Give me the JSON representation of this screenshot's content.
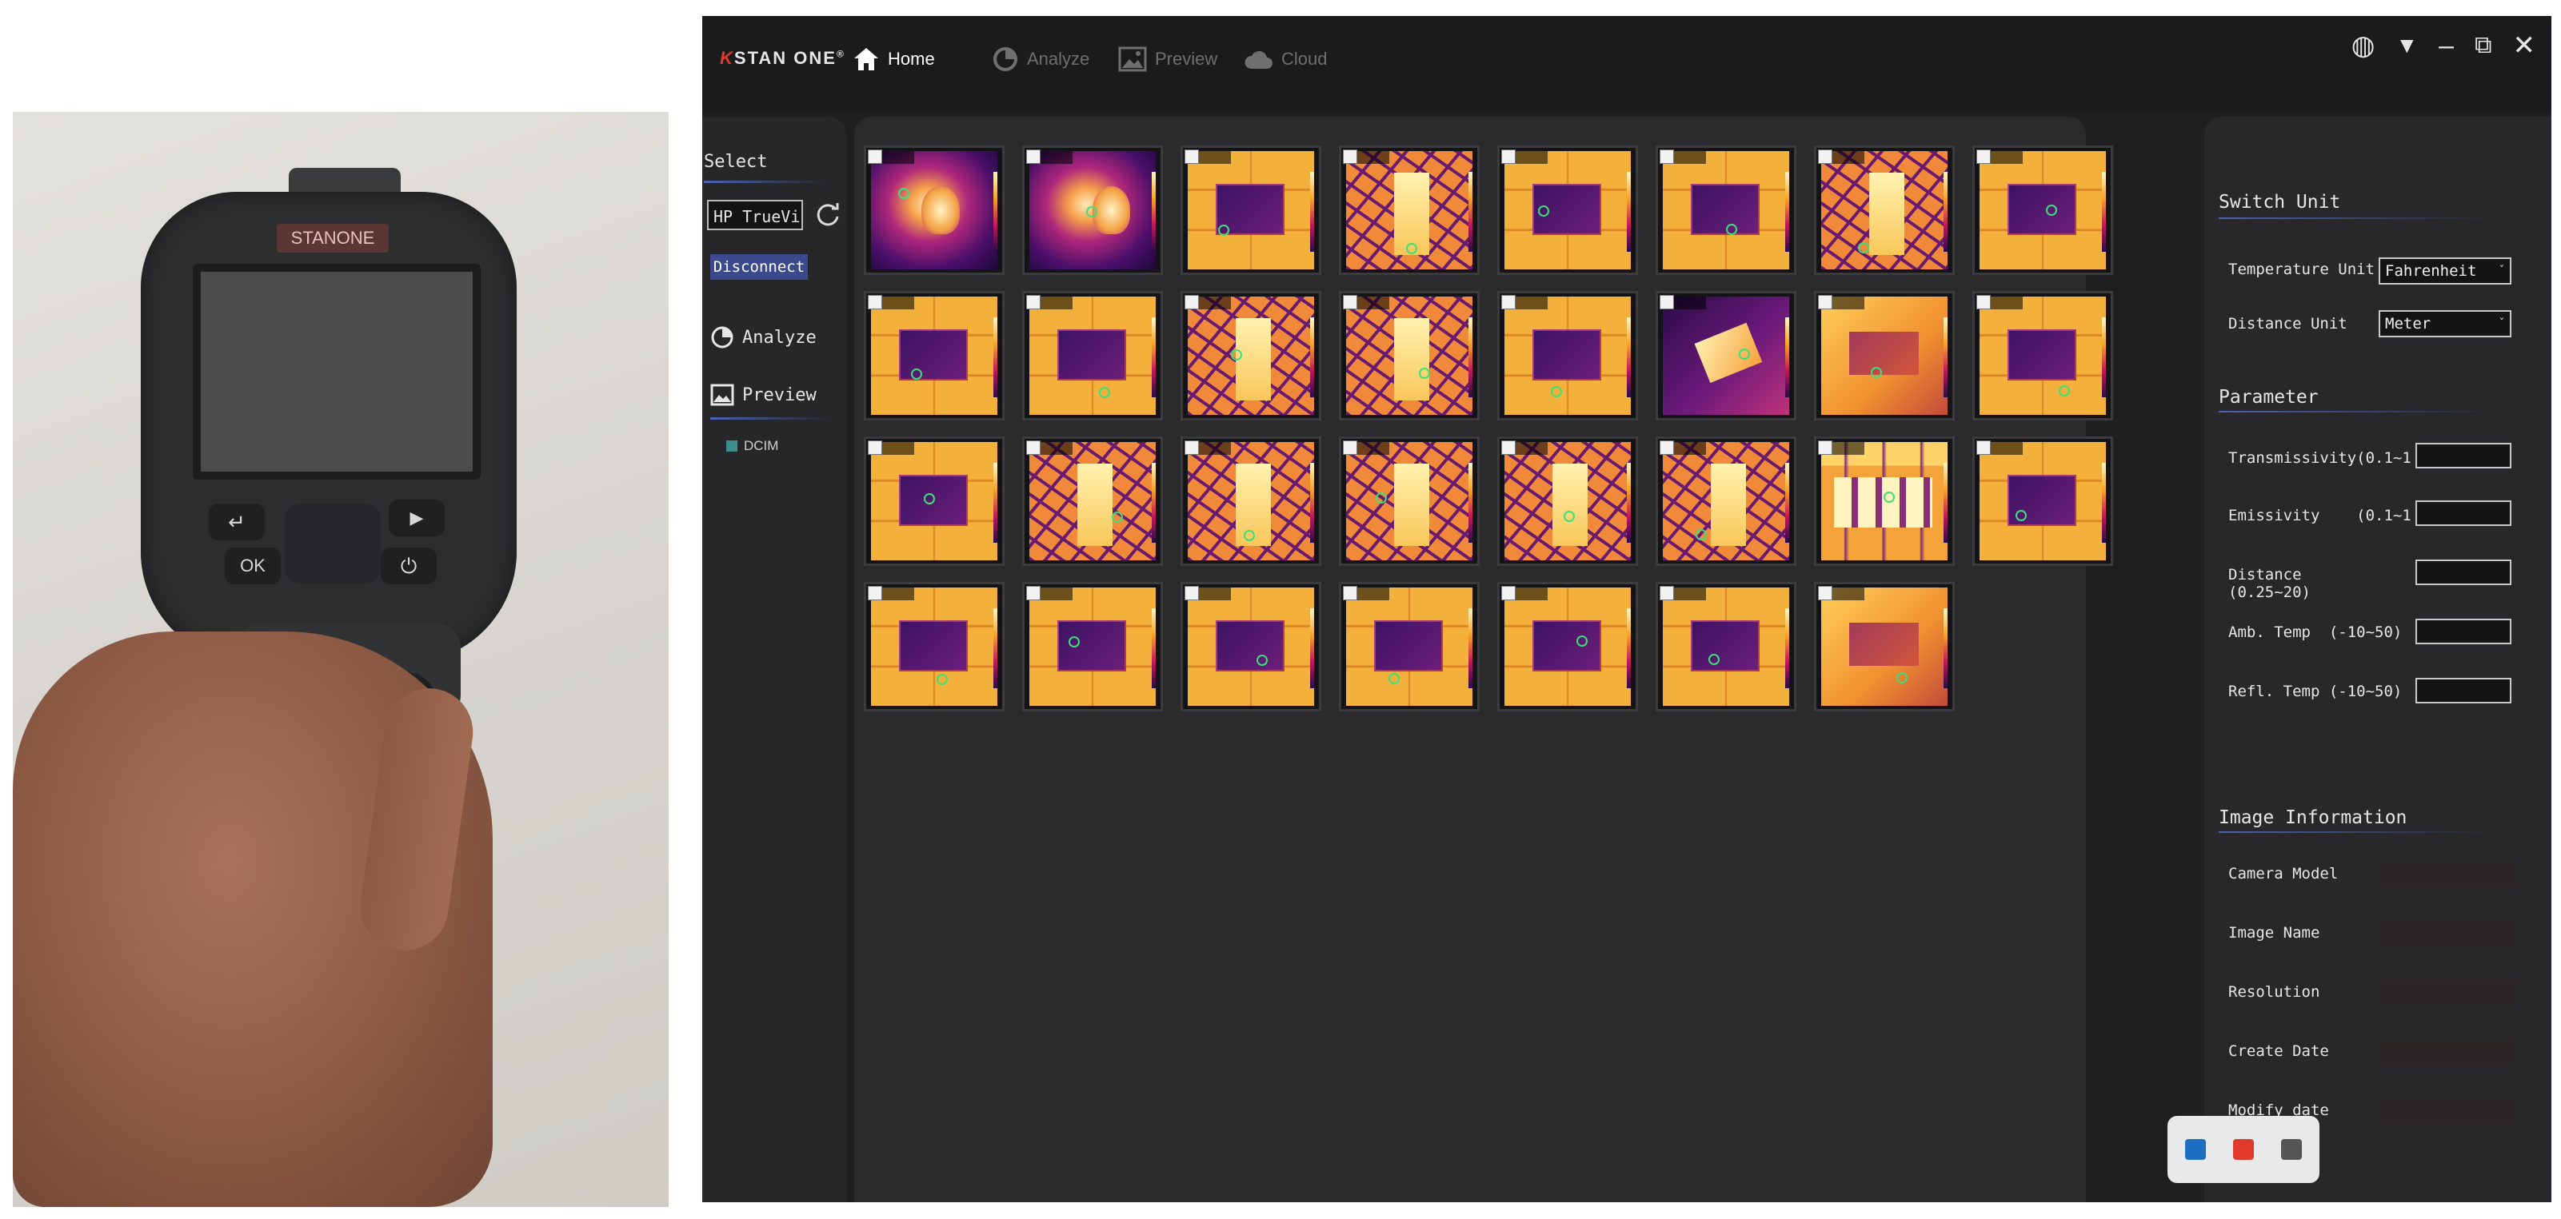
{
  "photo": {
    "camera_brand": "STANONE",
    "buttons": {
      "ok": "OK",
      "back": "↵",
      "play": "▶",
      "power": "⏻"
    }
  },
  "app": {
    "logo": {
      "mark": "K",
      "text": "STAN ONE",
      "reg": "®"
    },
    "nav": [
      {
        "label": "Home",
        "icon": "home-icon",
        "active": true
      },
      {
        "label": "Analyze",
        "icon": "analyze-icon",
        "active": false
      },
      {
        "label": "Preview",
        "icon": "preview-icon",
        "active": false
      },
      {
        "label": "Cloud",
        "icon": "cloud-icon",
        "active": false
      }
    ],
    "window_controls": [
      "globe-icon",
      "dropdown-icon",
      "minimize-icon",
      "maximize-icon",
      "close-icon"
    ],
    "sidebar": {
      "select_label": "Select",
      "device_value": "HP TrueVi",
      "disconnect_label": "Disconnect",
      "analyze_label": "Analyze",
      "preview_label": "Preview",
      "folder_label": "DCIM"
    },
    "gallery": {
      "thumbnails": [
        "t-person",
        "t-person",
        "t-brick",
        "t-crack",
        "t-brick",
        "t-brick",
        "t-crack",
        "t-brick",
        "t-brick",
        "t-brick",
        "t-crack",
        "t-crack",
        "t-brick",
        "t-dark",
        "t-warm",
        "t-brick",
        "t-brick",
        "t-crack",
        "t-crack",
        "t-crack",
        "t-crack",
        "t-crack",
        "t-cells",
        "t-brick",
        "t-brick",
        "t-brick",
        "t-brick",
        "t-brick",
        "t-brick",
        "t-brick",
        "t-warm"
      ]
    },
    "right_panel": {
      "switch_unit_title": "Switch Unit",
      "temperature_unit_label": "Temperature Unit",
      "temperature_unit_value": "Fahrenheit",
      "distance_unit_label": "Distance Unit",
      "distance_unit_value": "Meter",
      "parameter_title": "Parameter",
      "transmissivity_label": "Transmissivity(0.1~1",
      "emissivity_label": "Emissivity    (0.1~1",
      "distance_label": "Distance",
      "distance_range": "(0.25~20)",
      "amb_temp_label": "Amb. Temp  (-10~50)",
      "refl_temp_label": "Refl. Temp (-10~50)",
      "image_info_title": "Image Information",
      "camera_model_label": "Camera Model",
      "image_name_label": "Image Name",
      "resolution_label": "Resolution",
      "create_date_label": "Create Date",
      "modify_date_label": "Modify date"
    },
    "share_bar": {
      "items": [
        "linkedin-icon",
        "record-icon",
        "usb-icon"
      ],
      "colors": [
        "#1f6fc1",
        "#e03a2c",
        "#555555"
      ]
    }
  }
}
